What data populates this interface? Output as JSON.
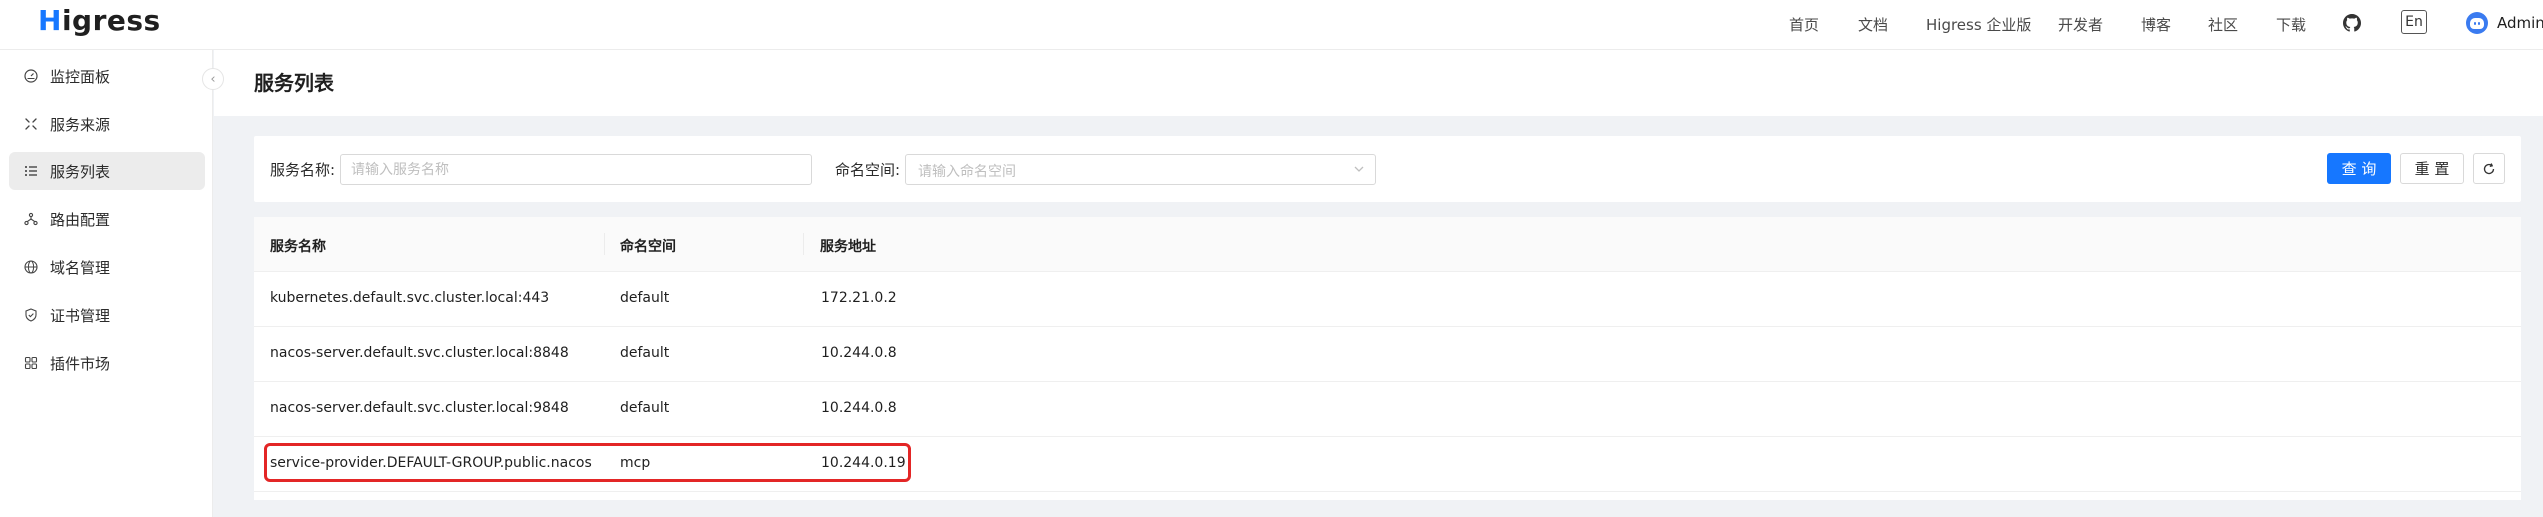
{
  "header": {
    "logo_h": "H",
    "logo_rest": "igress",
    "nav": [
      "首页",
      "文档",
      "Higress 企业版",
      "开发者",
      "博客",
      "社区",
      "下载"
    ],
    "github_icon": "github-icon",
    "lang_label": "En",
    "user_name": "Admin"
  },
  "sidebar": {
    "items": [
      {
        "label": "监控面板",
        "icon": "dashboard-icon"
      },
      {
        "label": "服务来源",
        "icon": "service-source-icon"
      },
      {
        "label": "服务列表",
        "icon": "list-icon",
        "active": true
      },
      {
        "label": "路由配置",
        "icon": "route-icon"
      },
      {
        "label": "域名管理",
        "icon": "globe-icon"
      },
      {
        "label": "证书管理",
        "icon": "shield-icon"
      },
      {
        "label": "插件市场",
        "icon": "plugin-icon"
      }
    ]
  },
  "page": {
    "title": "服务列表"
  },
  "filter": {
    "service_name_label": "服务名称:",
    "service_name_placeholder": "请输入服务名称",
    "namespace_label": "命名空间:",
    "namespace_placeholder": "请输入命名空间",
    "search_label": "查 询",
    "reset_label": "重 置",
    "refresh_icon": "refresh-icon"
  },
  "table": {
    "columns": [
      "服务名称",
      "命名空间",
      "服务地址"
    ],
    "rows": [
      {
        "name": "kubernetes.default.svc.cluster.local:443",
        "namespace": "default",
        "address": "172.21.0.2"
      },
      {
        "name": "nacos-server.default.svc.cluster.local:8848",
        "namespace": "default",
        "address": "10.244.0.8"
      },
      {
        "name": "nacos-server.default.svc.cluster.local:9848",
        "namespace": "default",
        "address": "10.244.0.8"
      },
      {
        "name": "service-provider.DEFAULT-GROUP.public.nacos",
        "namespace": "mcp",
        "address": "10.244.0.19"
      }
    ]
  },
  "colors": {
    "primary": "#1677ff",
    "highlight": "#e32626",
    "active_menu_bg": "#ececec"
  }
}
